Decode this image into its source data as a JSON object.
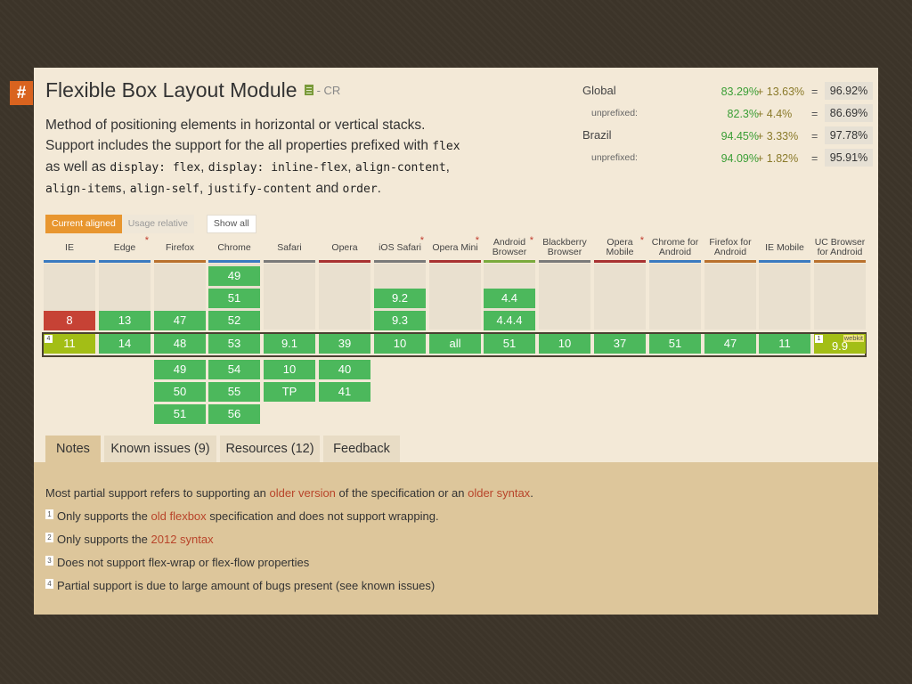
{
  "hash_label": "#",
  "feature": {
    "title": "Flexible Box Layout Module",
    "status": "- CR",
    "desc": {
      "p1": "Method of positioning elements in horizontal or vertical stacks. Support includes the support for the all properties prefixed with",
      "c1": "flex",
      "t1": "as well as",
      "c2": "display: flex",
      "t2": ",",
      "c3": "display: inline-flex",
      "t3": ",",
      "c4": "align-content",
      "t4": ",",
      "c5": "align-items",
      "t5": ",",
      "c6": "align-self",
      "t6": ",",
      "c7": "justify-content",
      "t7": "and",
      "c8": "order",
      "t8": "."
    }
  },
  "stats": [
    {
      "label": "Global",
      "sub": false,
      "supported": "83.29%",
      "partial": "+ 13.63%",
      "eq": "=",
      "total": "96.92%"
    },
    {
      "label": "unprefixed:",
      "sub": true,
      "supported": "82.3%",
      "partial": "+ 4.4%",
      "eq": "=",
      "total": "86.69%"
    },
    {
      "label": "Brazil",
      "sub": false,
      "supported": "94.45%",
      "partial": "+ 3.33%",
      "eq": "=",
      "total": "97.78%"
    },
    {
      "label": "unprefixed:",
      "sub": true,
      "supported": "94.09%",
      "partial": "+ 1.82%",
      "eq": "=",
      "total": "95.91%"
    }
  ],
  "filters": {
    "current": "Current aligned",
    "usage": "Usage relative",
    "show_all": "Show all"
  },
  "colors": {
    "supported": "#4cb85c",
    "unsupported": "#c64235",
    "partial": "#a3be16",
    "accent": "#d9631f"
  },
  "browsers": [
    {
      "name": "IE",
      "line": "#3a7ac0",
      "star": false,
      "before": [
        {
          "v": "8",
          "s": "n"
        }
      ],
      "current": {
        "v": "11",
        "s": "a",
        "note": "4"
      },
      "after": []
    },
    {
      "name": "Edge",
      "line": "#3a7ac0",
      "star": true,
      "before": [
        {
          "v": "13",
          "s": "y"
        }
      ],
      "current": {
        "v": "14",
        "s": "y"
      },
      "after": []
    },
    {
      "name": "Firefox",
      "line": "#b9712d",
      "star": false,
      "before": [
        {
          "v": "47",
          "s": "y"
        }
      ],
      "current": {
        "v": "48",
        "s": "y"
      },
      "after": [
        {
          "v": "49",
          "s": "y"
        },
        {
          "v": "50",
          "s": "y"
        },
        {
          "v": "51",
          "s": "y"
        }
      ]
    },
    {
      "name": "Chrome",
      "line": "#3a7ac0",
      "star": false,
      "before": [
        {
          "v": "49",
          "s": "y"
        },
        {
          "v": "51",
          "s": "y"
        },
        {
          "v": "52",
          "s": "y"
        }
      ],
      "current": {
        "v": "53",
        "s": "y"
      },
      "after": [
        {
          "v": "54",
          "s": "y"
        },
        {
          "v": "55",
          "s": "y"
        },
        {
          "v": "56",
          "s": "y"
        }
      ]
    },
    {
      "name": "Safari",
      "line": "#7a7a7a",
      "star": false,
      "before": [],
      "current": {
        "v": "9.1",
        "s": "y"
      },
      "after": [
        {
          "v": "10",
          "s": "y"
        },
        {
          "v": "TP",
          "s": "y"
        }
      ]
    },
    {
      "name": "Opera",
      "line": "#a83232",
      "star": false,
      "before": [],
      "current": {
        "v": "39",
        "s": "y"
      },
      "after": [
        {
          "v": "40",
          "s": "y"
        },
        {
          "v": "41",
          "s": "y"
        }
      ]
    },
    {
      "name": "iOS Safari",
      "line": "#7a7a7a",
      "star": true,
      "before": [
        {
          "v": "9.2",
          "s": "y"
        },
        {
          "v": "9.3",
          "s": "y"
        }
      ],
      "current": {
        "v": "10",
        "s": "y"
      },
      "after": []
    },
    {
      "name": "Opera Mini",
      "line": "#a83232",
      "star": true,
      "before": [],
      "current": {
        "v": "all",
        "s": "y"
      },
      "after": []
    },
    {
      "name": "Android Browser",
      "line": "#7aaa3c",
      "star": true,
      "before": [
        {
          "v": "4.4",
          "s": "y"
        },
        {
          "v": "4.4.4",
          "s": "y"
        }
      ],
      "current": {
        "v": "51",
        "s": "y"
      },
      "after": []
    },
    {
      "name": "Blackberry Browser",
      "line": "#7a7a7a",
      "star": false,
      "before": [],
      "current": {
        "v": "10",
        "s": "y"
      },
      "after": []
    },
    {
      "name": "Opera Mobile",
      "line": "#a83232",
      "star": true,
      "before": [],
      "current": {
        "v": "37",
        "s": "y"
      },
      "after": []
    },
    {
      "name": "Chrome for Android",
      "line": "#3a7ac0",
      "star": false,
      "before": [],
      "current": {
        "v": "51",
        "s": "y"
      },
      "after": []
    },
    {
      "name": "Firefox for Android",
      "line": "#b9712d",
      "star": false,
      "before": [],
      "current": {
        "v": "47",
        "s": "y"
      },
      "after": []
    },
    {
      "name": "IE Mobile",
      "line": "#3a7ac0",
      "star": false,
      "before": [],
      "current": {
        "v": "11",
        "s": "y"
      },
      "after": []
    },
    {
      "name": "UC Browser for Android",
      "line": "#b9712d",
      "star": false,
      "before": [],
      "current": {
        "v": "9.9",
        "s": "a",
        "note": "1",
        "prefix": "webkit"
      },
      "after": []
    }
  ],
  "tabs": [
    {
      "label": "Notes",
      "active": true
    },
    {
      "label": "Known issues (9)",
      "active": false
    },
    {
      "label": "Resources (12)",
      "active": false
    },
    {
      "label": "Feedback",
      "active": false
    }
  ],
  "notes": {
    "general": {
      "t1": "Most partial support refers to supporting an",
      "l1": "older version",
      "t2": "of the specification or an",
      "l2": "older syntax",
      "t3": "."
    },
    "n1": {
      "num": "1",
      "t1": "Only supports the",
      "link": "old flexbox",
      "t2": "specification and does not support wrapping."
    },
    "n2": {
      "num": "2",
      "t1": "Only supports the",
      "link": "2012 syntax"
    },
    "n3": {
      "num": "3",
      "text": "Does not support flex-wrap or flex-flow properties"
    },
    "n4": {
      "num": "4",
      "text": "Partial support is due to large amount of bugs present (see known issues)"
    }
  }
}
